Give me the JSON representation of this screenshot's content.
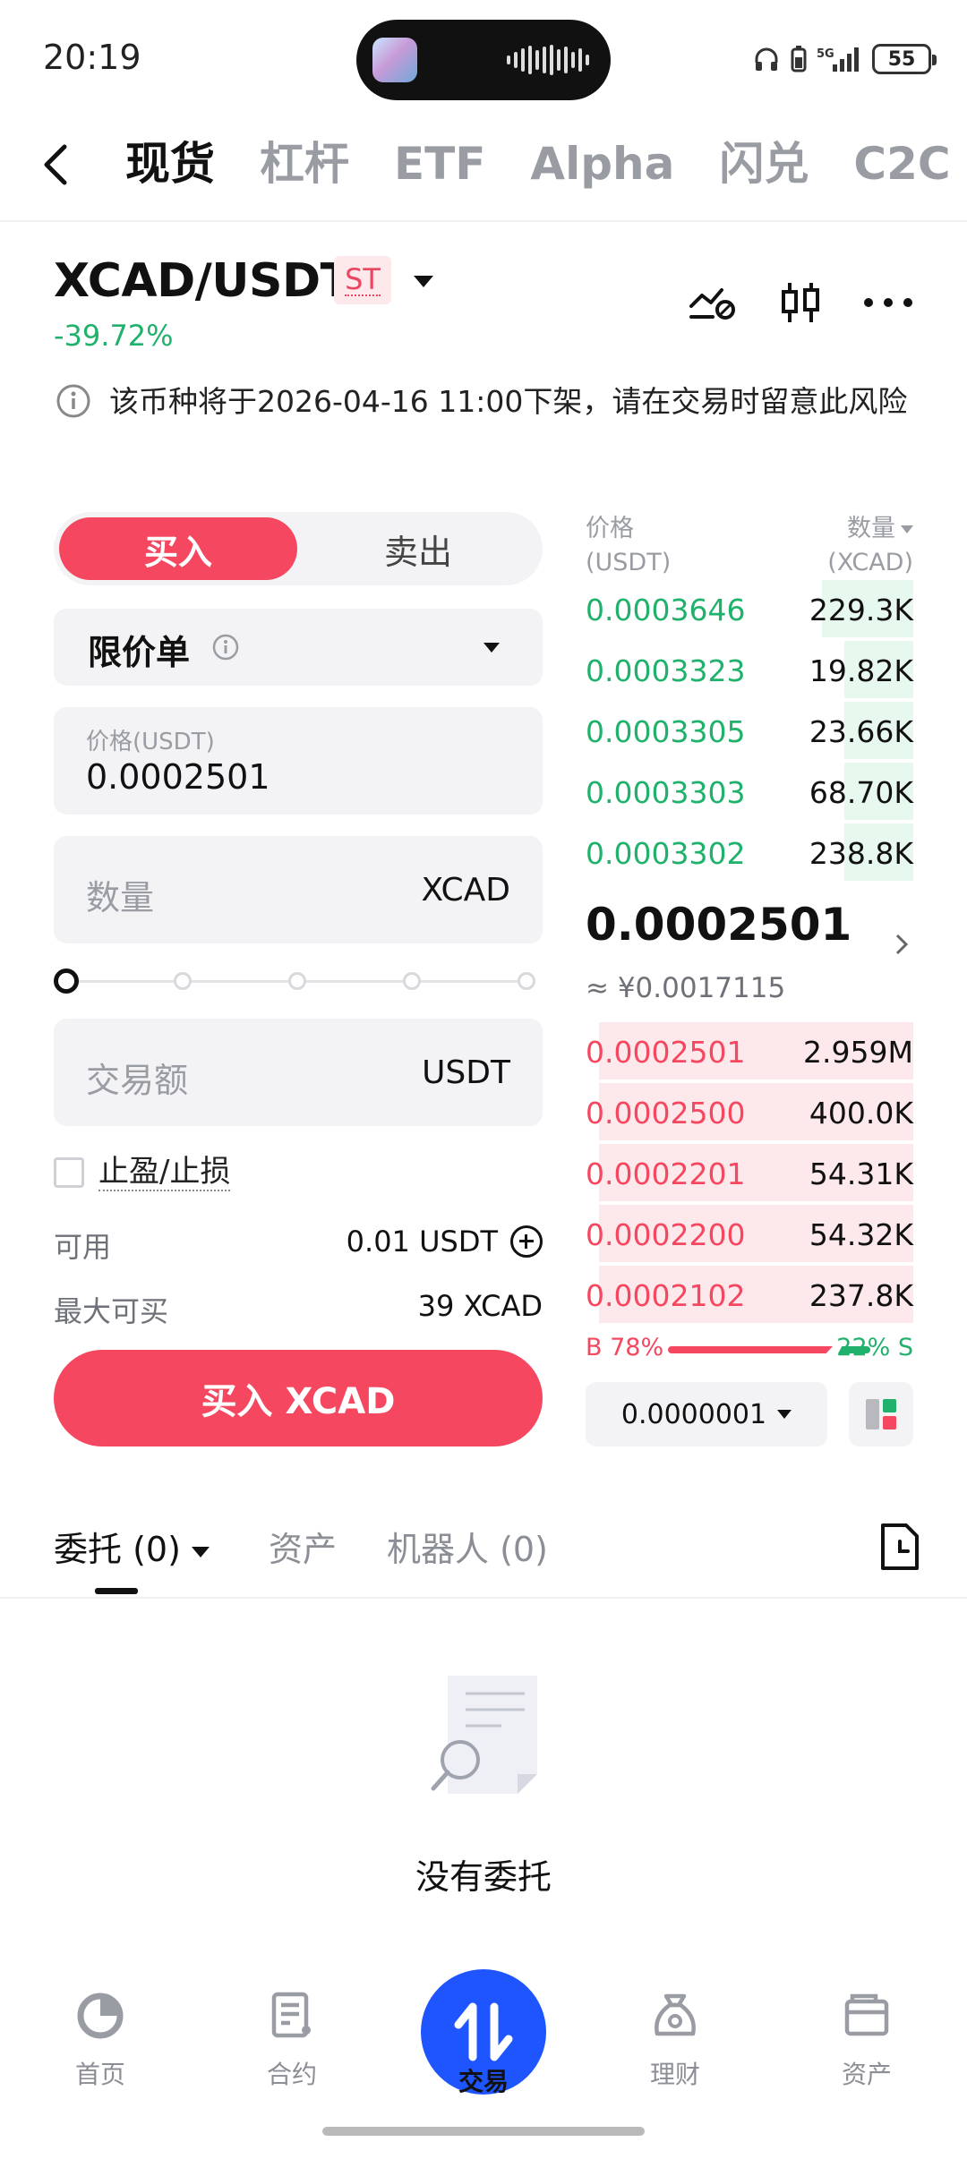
{
  "status_bar": {
    "time": "20:19",
    "network": "5G",
    "battery": "55"
  },
  "top_nav": {
    "tabs": [
      {
        "label": "现货",
        "active": true
      },
      {
        "label": "杠杆"
      },
      {
        "label": "ETF"
      },
      {
        "label": "Alpha"
      },
      {
        "label": "闪兑"
      },
      {
        "label": "C2C"
      }
    ]
  },
  "pair": {
    "name": "XCAD/USDT",
    "badge": "ST",
    "change": "-39.72%"
  },
  "notice": {
    "text": "该币种将于2026-04-16 11:00下架，请在交易时留意此风险"
  },
  "order_form": {
    "buy_label": "买入",
    "sell_label": "卖出",
    "order_type": "限价单",
    "price_label": "价格(USDT)",
    "price_value": "0.0002501",
    "quantity_placeholder": "数量",
    "quantity_unit": "XCAD",
    "amount_placeholder": "交易额",
    "amount_unit": "USDT",
    "tpsl_label": "止盈/止损",
    "available_label": "可用",
    "available_value": "0.01 USDT",
    "max_buy_label": "最大可买",
    "max_buy_value": "39 XCAD",
    "submit_label": "买入 XCAD"
  },
  "order_book": {
    "price_header": "价格",
    "price_unit": "(USDT)",
    "qty_header": "数量",
    "qty_unit": "(XCAD)",
    "asks": [
      {
        "price": "0.0003646",
        "qty": "229.3K",
        "depth": 0.28
      },
      {
        "price": "0.0003323",
        "qty": "19.82K",
        "depth": 0.21
      },
      {
        "price": "0.0003305",
        "qty": "23.66K",
        "depth": 0.21
      },
      {
        "price": "0.0003303",
        "qty": "68.70K",
        "depth": 0.21
      },
      {
        "price": "0.0003302",
        "qty": "238.8K",
        "depth": 0.21
      }
    ],
    "last_price": "0.0002501",
    "last_price_fiat": "≈ ¥0.0017115",
    "bids": [
      {
        "price": "0.0002501",
        "qty": "2.959M",
        "depth": 0.96
      },
      {
        "price": "0.0002500",
        "qty": "400.0K",
        "depth": 0.96
      },
      {
        "price": "0.0002201",
        "qty": "54.31K",
        "depth": 0.96
      },
      {
        "price": "0.0002200",
        "qty": "54.32K",
        "depth": 0.96
      },
      {
        "price": "0.0002102",
        "qty": "237.8K",
        "depth": 0.96
      }
    ],
    "buy_ratio": "B 78%",
    "sell_ratio": "22% S",
    "precision": "0.0000001"
  },
  "orders_section": {
    "tabs": [
      {
        "label": "委托 (0)",
        "active": true
      },
      {
        "label": "资产"
      },
      {
        "label": "机器人 (0)"
      }
    ],
    "empty_text": "没有委托"
  },
  "bottom_nav": {
    "items": [
      {
        "label": "首页"
      },
      {
        "label": "合约"
      },
      {
        "label": "交易",
        "active": true
      },
      {
        "label": "理财"
      },
      {
        "label": "资产"
      }
    ]
  },
  "colors": {
    "buy": "#f5475f",
    "sell": "#20b26c",
    "brand_blue": "#1f55ff"
  }
}
